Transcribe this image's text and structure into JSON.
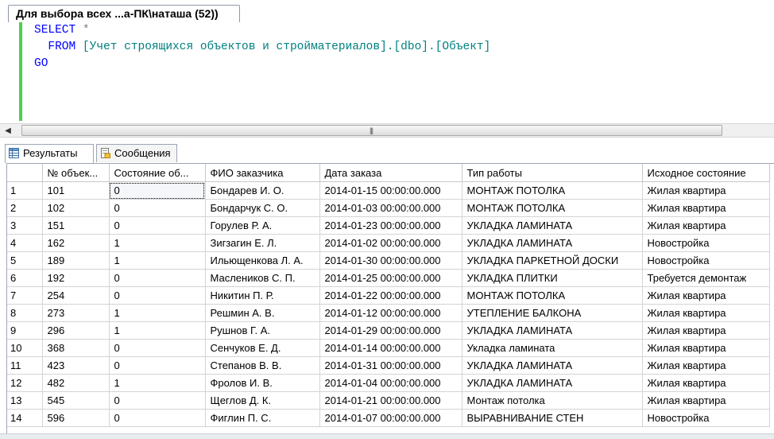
{
  "document_tab": {
    "title": "Для выбора всех ...а-ПК\\наташа (52))"
  },
  "editor": {
    "line1": {
      "kw": "SELECT",
      "rest": " *"
    },
    "line2": {
      "indent": "  ",
      "kw": "FROM",
      "object": " [Учет строящихся объектов и стройматериалов].[dbo].[Объект]"
    },
    "line3": {
      "kw": "GO"
    }
  },
  "results_tabs": [
    {
      "label": "Результаты",
      "icon": "grid-icon",
      "active": true
    },
    {
      "label": "Сообщения",
      "icon": "message-icon",
      "active": false
    }
  ],
  "grid": {
    "columns": [
      "",
      "№ объек...",
      "Состояние об...",
      "ФИО заказчика",
      "Дата заказа",
      "Тип работы",
      "Исходное состояние"
    ],
    "rows": [
      [
        "1",
        "101",
        "0",
        "Бондарев И. О.",
        "2014-01-15 00:00:00.000",
        "МОНТАЖ ПОТОЛКА",
        "Жилая квартира"
      ],
      [
        "2",
        "102",
        "0",
        "Бондарчук С. О.",
        "2014-01-03 00:00:00.000",
        "МОНТАЖ ПОТОЛКА",
        "Жилая квартира"
      ],
      [
        "3",
        "151",
        "0",
        "Горулев Р. А.",
        "2014-01-23 00:00:00.000",
        "УКЛАДКА ЛАМИНАТА",
        "Жилая квартира"
      ],
      [
        "4",
        "162",
        "1",
        "Зигзагин Е. Л.",
        "2014-01-02 00:00:00.000",
        "УКЛАДКА ЛАМИНАТА",
        "Новостройка"
      ],
      [
        "5",
        "189",
        "1",
        "Ильющенкова Л. А.",
        "2014-01-30 00:00:00.000",
        "УКЛАДКА ПАРКЕТНОЙ ДОСКИ",
        "Новостройка"
      ],
      [
        "6",
        "192",
        "0",
        "Маслеников С. П.",
        "2014-01-25 00:00:00.000",
        "УКЛАДКА ПЛИТКИ",
        "Требуется демонтаж"
      ],
      [
        "7",
        "254",
        "0",
        "Никитин П. Р.",
        "2014-01-22 00:00:00.000",
        "МОНТАЖ ПОТОЛКА",
        "Жилая квартира"
      ],
      [
        "8",
        "273",
        "1",
        "Решмин А. В.",
        "2014-01-12 00:00:00.000",
        "УТЕПЛЕНИЕ БАЛКОНА",
        "Жилая квартира"
      ],
      [
        "9",
        "296",
        "1",
        "Рушнов Г. А.",
        "2014-01-29 00:00:00.000",
        "УКЛАДКА ЛАМИНАТА",
        "Жилая квартира"
      ],
      [
        "10",
        "368",
        "0",
        "Сенчуков Е. Д.",
        "2014-01-14 00:00:00.000",
        "Укладка ламината",
        "Жилая квартира"
      ],
      [
        "11",
        "423",
        "0",
        "Степанов В. В.",
        "2014-01-31 00:00:00.000",
        "УКЛАДКА ЛАМИНАТА",
        "Жилая квартира"
      ],
      [
        "12",
        "482",
        "1",
        "Фролов И. В.",
        "2014-01-04 00:00:00.000",
        "УКЛАДКА ЛАМИНАТА",
        "Жилая квартира"
      ],
      [
        "13",
        "545",
        "0",
        "Щеглов Д. К.",
        "2014-01-21 00:00:00.000",
        "Монтаж потолка",
        "Жилая квартира"
      ],
      [
        "14",
        "596",
        "0",
        "Фиглин П. С.",
        "2014-01-07 00:00:00.000",
        "ВЫРАВНИВАНИЕ СТЕН",
        "Новостройка"
      ]
    ]
  },
  "colors": {
    "keyword": "#0000ff",
    "object": "#008080",
    "operator": "#808080",
    "change_bar": "#4bd14b"
  }
}
